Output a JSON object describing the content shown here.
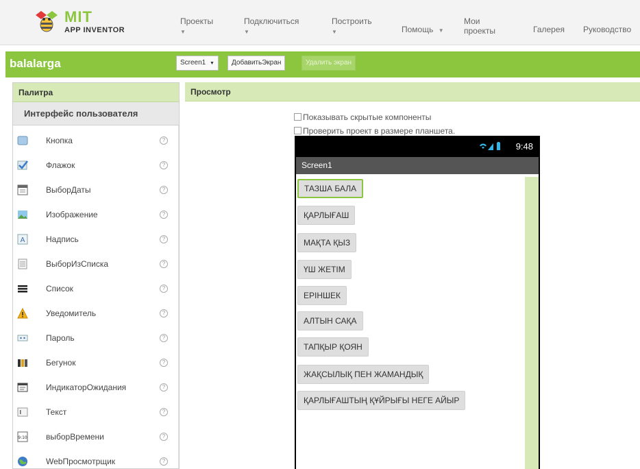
{
  "app": {
    "logo_title": "MIT",
    "logo_subtitle": "APP INVENTOR"
  },
  "nav": [
    {
      "label": "Проекты",
      "has_caret": true
    },
    {
      "label": "Подключиться",
      "has_caret": true
    },
    {
      "label": "Построить",
      "has_caret": true
    },
    {
      "label": "Помощь",
      "has_caret": true
    },
    {
      "label": "Мои проекты",
      "has_caret": false
    },
    {
      "label": "Галерея",
      "has_caret": false
    },
    {
      "label": "Руководство",
      "has_caret": false
    }
  ],
  "project": {
    "name": "balalarga",
    "screen_select": "Screen1",
    "add_screen_label": "ДобавитьЭкран",
    "remove_screen_label": "Удалить экран"
  },
  "palette": {
    "title": "Палитра",
    "section": "Интерфейс пользователя",
    "help_glyph": "?",
    "items": [
      {
        "label": "Кнопка",
        "icon": "button-icon"
      },
      {
        "label": "Флажок",
        "icon": "checkbox-icon"
      },
      {
        "label": "ВыборДаты",
        "icon": "datepicker-icon"
      },
      {
        "label": "Изображение",
        "icon": "image-icon"
      },
      {
        "label": "Надпись",
        "icon": "label-icon"
      },
      {
        "label": "ВыборИзСписка",
        "icon": "listpicker-icon"
      },
      {
        "label": "Список",
        "icon": "listview-icon"
      },
      {
        "label": "Уведомитель",
        "icon": "notifier-icon"
      },
      {
        "label": "Пароль",
        "icon": "password-icon"
      },
      {
        "label": "Бегунок",
        "icon": "slider-icon"
      },
      {
        "label": "ИндикаторОжидания",
        "icon": "spinner-icon"
      },
      {
        "label": "Текст",
        "icon": "textbox-icon"
      },
      {
        "label": "выборВремени",
        "icon": "timepicker-icon"
      },
      {
        "label": "WebПросмотрщик",
        "icon": "webviewer-icon"
      }
    ]
  },
  "viewer": {
    "title": "Просмотр",
    "show_hidden_label": "Показывать скрытые компоненты",
    "tablet_preview_label": "Проверить проект в размере планшета."
  },
  "phone": {
    "time": "9:48",
    "screen_title": "Screen1",
    "buttons": [
      "ТАЗША БАЛА",
      "ҚАРЛЫҒАШ",
      "МАҚТА ҚЫЗ",
      "ҮШ ЖЕТІМ",
      "ЕРІНШЕК",
      "АЛТЫН САҚА",
      "ТАПҚЫР ҚОЯН",
      "ЖАҚСЫЛЫҚ ПЕН ЖАМАНДЫҚ",
      "ҚАРЛЫҒАШТЫҢ ҚҰЙРЫҒЫ НЕГЕ АЙЫР"
    ],
    "selected_index": 0
  },
  "colors": {
    "accent": "#8cc63f",
    "panel_header": "#d6e9b6"
  }
}
